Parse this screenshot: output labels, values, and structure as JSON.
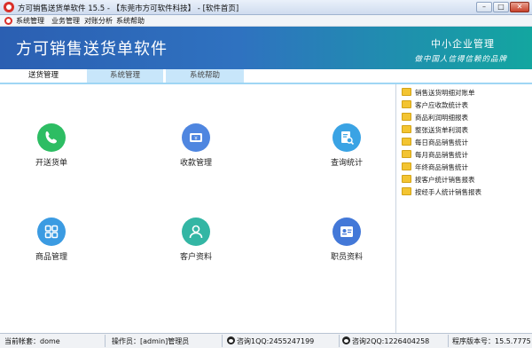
{
  "window": {
    "title": "方可销售送货单软件 15.5 - 【东莞市方可软件科技】 - [软件首页]",
    "min_label": "–",
    "max_label": "□",
    "close_label": "✕"
  },
  "menu": {
    "items": [
      "系统管理",
      "业务管理",
      "对账分析",
      "系统帮助"
    ]
  },
  "banner": {
    "app_title": "方可销售送货单软件",
    "slogan_line1": "中小企业管理",
    "slogan_line2": "做中国人信得信赖的品牌"
  },
  "tabs": [
    {
      "label": "送货管理",
      "active": true
    },
    {
      "label": "系统管理",
      "active": false
    },
    {
      "label": "系统帮助",
      "active": false
    }
  ],
  "features": [
    {
      "label": "开送货单",
      "icon": "phone-icon",
      "color": "#2dbd63"
    },
    {
      "label": "收款管理",
      "icon": "banknote-icon",
      "color": "#4f86e0"
    },
    {
      "label": "查询统计",
      "icon": "search-document-icon",
      "color": "#3aa3e4"
    },
    {
      "label": "商品管理",
      "icon": "grid-icon",
      "color": "#3b9be2"
    },
    {
      "label": "客户资料",
      "icon": "person-icon",
      "color": "#33b6a4"
    },
    {
      "label": "职员资料",
      "icon": "id-card-icon",
      "color": "#4378d8"
    }
  ],
  "reports": [
    "销售送货明细对账单",
    "客户应收款统计表",
    "商品利润明细报表",
    "整张送货单利润表",
    "每日商品销售统计",
    "每月商品销售统计",
    "年终商品销售统计",
    "按客户统计销售报表",
    "按经手人统计销售报表"
  ],
  "status": {
    "account": "当前帐套：dome",
    "operator": "操作员：[admin]管理员",
    "qq1": "咨询1QQ:2455247199",
    "qq2": "咨询2QQ:1226404258",
    "version": "程序版本号：15.5.7775"
  }
}
